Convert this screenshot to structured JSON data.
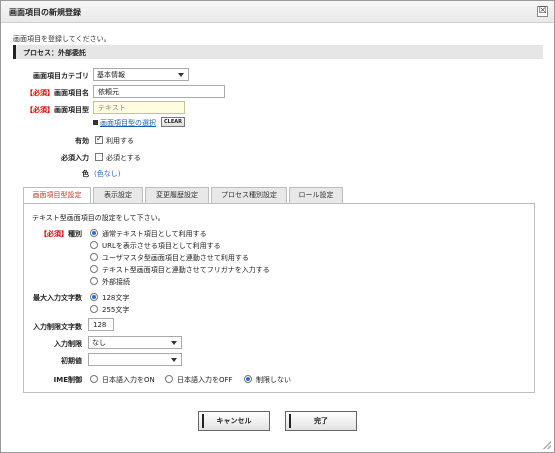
{
  "window": {
    "title": "画面項目の新規登録",
    "close_glyph": "☒"
  },
  "intro": "画面項目を登録してください。",
  "process_bar": "プロセス：外部委託",
  "required_tag": "【必須】",
  "fields": {
    "category": {
      "label": "画面項目カテゴリ",
      "value": "基本情報"
    },
    "name": {
      "label": "画面項目名",
      "value": "依頼元"
    },
    "type": {
      "label": "画面項目型",
      "value": "テキスト",
      "select_link": "画面項目型の選択",
      "clear_label": "CLEAR"
    },
    "enabled": {
      "label": "有効",
      "checkbox_label": "利用する",
      "checked": true
    },
    "required_input": {
      "label": "必須入力",
      "checkbox_label": "必須とする",
      "checked": false
    },
    "color": {
      "label": "色",
      "value": "(色なし)"
    }
  },
  "tabs": [
    {
      "label": "画面項目型設定",
      "active": true
    },
    {
      "label": "表示設定",
      "active": false
    },
    {
      "label": "変更履歴設定",
      "active": false
    },
    {
      "label": "プロセス種別設定",
      "active": false
    },
    {
      "label": "ロール設定",
      "active": false
    }
  ],
  "panel": {
    "description": "テキスト型画面項目の設定をして下さい。",
    "kind": {
      "label": "種別",
      "options": [
        {
          "label": "通常テキスト項目として利用する",
          "selected": true
        },
        {
          "label": "URLを表示させる項目として利用する",
          "selected": false
        },
        {
          "label": "ユーザマスタ型画面項目と連動させて利用する",
          "selected": false
        },
        {
          "label": "テキスト型画面項目と連動させてフリガナを入力する",
          "selected": false
        },
        {
          "label": "外部接続",
          "selected": false
        }
      ]
    },
    "max_chars": {
      "label": "最大入力文字数",
      "options": [
        {
          "label": "128文字",
          "selected": true
        },
        {
          "label": "255文字",
          "selected": false
        }
      ]
    },
    "limit_chars": {
      "label": "入力制限文字数",
      "value": "128"
    },
    "input_restriction": {
      "label": "入力制限",
      "value": "なし"
    },
    "initial_value": {
      "label": "初期値",
      "value": ""
    },
    "ime": {
      "label": "IME制御",
      "options": [
        {
          "label": "日本語入力をON",
          "selected": false
        },
        {
          "label": "日本語入力をOFF",
          "selected": false
        },
        {
          "label": "制限しない",
          "selected": true
        }
      ]
    }
  },
  "buttons": {
    "cancel": "キャンセル",
    "done": "完了"
  }
}
